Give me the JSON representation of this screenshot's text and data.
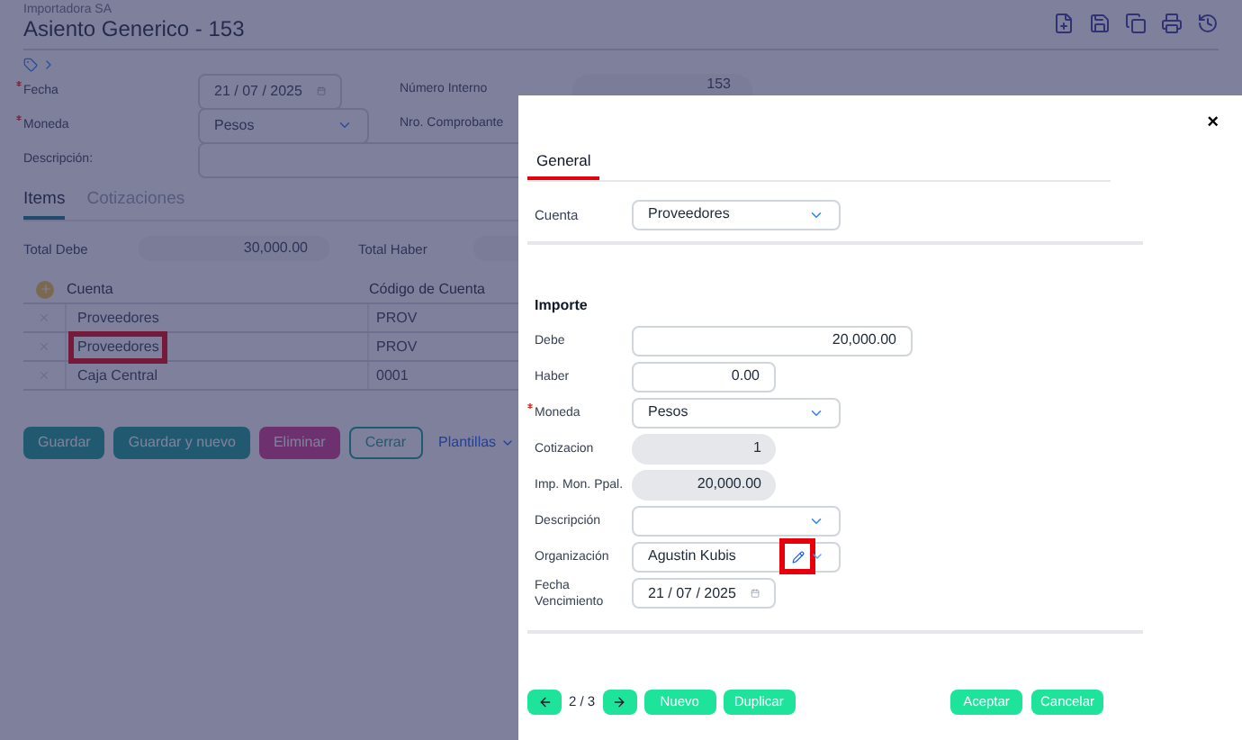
{
  "company": "Importadora SA",
  "title": "Asiento Generico - 153",
  "left_fields": [
    {
      "label": "Fecha",
      "required": true,
      "kind": "date",
      "value": "21 / 07 / 2025"
    },
    {
      "label": "Moneda",
      "required": true,
      "kind": "select",
      "value": "Pesos"
    },
    {
      "label": "Descripción:",
      "required": false,
      "kind": "text"
    }
  ],
  "right_fields": [
    {
      "label": "Número Interno",
      "kind": "readonly",
      "value": "153"
    },
    {
      "label": "Nro. Comprobante"
    }
  ],
  "tabs": [
    {
      "label": "Items",
      "selected": true
    },
    {
      "label": "Cotizaciones",
      "selected": false
    }
  ],
  "totals": [
    {
      "label": "Total Debe",
      "value": "30,000.00"
    },
    {
      "label": "Total Haber"
    }
  ],
  "table": {
    "columns": [
      "Cuenta",
      "Código de Cuenta"
    ],
    "rows": [
      {
        "cells": [
          "Proveedores",
          "PROV"
        ],
        "highlighted": false
      },
      {
        "cells": [
          "Proveedores",
          "PROV"
        ],
        "highlighted": true
      },
      {
        "cells": [
          "Caja Central",
          "0001"
        ],
        "highlighted": false
      }
    ]
  },
  "buttons": [
    {
      "label": "Guardar",
      "kind": "primary"
    },
    {
      "label": "Guardar y nuevo",
      "kind": "primary"
    },
    {
      "label": "Eliminar",
      "kind": "danger"
    },
    {
      "label": "Cerrar",
      "kind": "outline"
    },
    {
      "label": "Plantillas",
      "kind": "link"
    }
  ],
  "dialog": {
    "close": "×",
    "tabs": [
      {
        "label": "General",
        "selected": true
      }
    ],
    "cuenta": {
      "label": "Cuenta",
      "value": "Proveedores"
    },
    "section": "Importe",
    "fields": [
      {
        "label": "Debe",
        "kind": "input",
        "value": "20,000.00",
        "required": false
      },
      {
        "label": "Haber",
        "kind": "input",
        "value": "0.00",
        "required": false
      },
      {
        "label": "Moneda",
        "kind": "select",
        "value": "Pesos",
        "required": true
      },
      {
        "label": "Cotizacion",
        "kind": "readonly",
        "value": "1",
        "required": false
      },
      {
        "label": "Imp. Mon. Ppal.",
        "kind": "readonly",
        "value": "20,000.00",
        "required": false
      },
      {
        "label": "Descripción",
        "kind": "select",
        "required": false
      },
      {
        "label": "Organización",
        "kind": "select_edit",
        "value": "Agustin Kubis",
        "required": false,
        "highlighted": true
      },
      {
        "label": "Fecha Vencimiento",
        "kind": "date",
        "value": "21 / 07 / 2025",
        "required": false
      }
    ],
    "pager": "2 / 3",
    "left_buttons": [
      "Nuevo",
      "Duplicar"
    ],
    "right_buttons": [
      "Aceptar",
      "Cancelar"
    ]
  }
}
